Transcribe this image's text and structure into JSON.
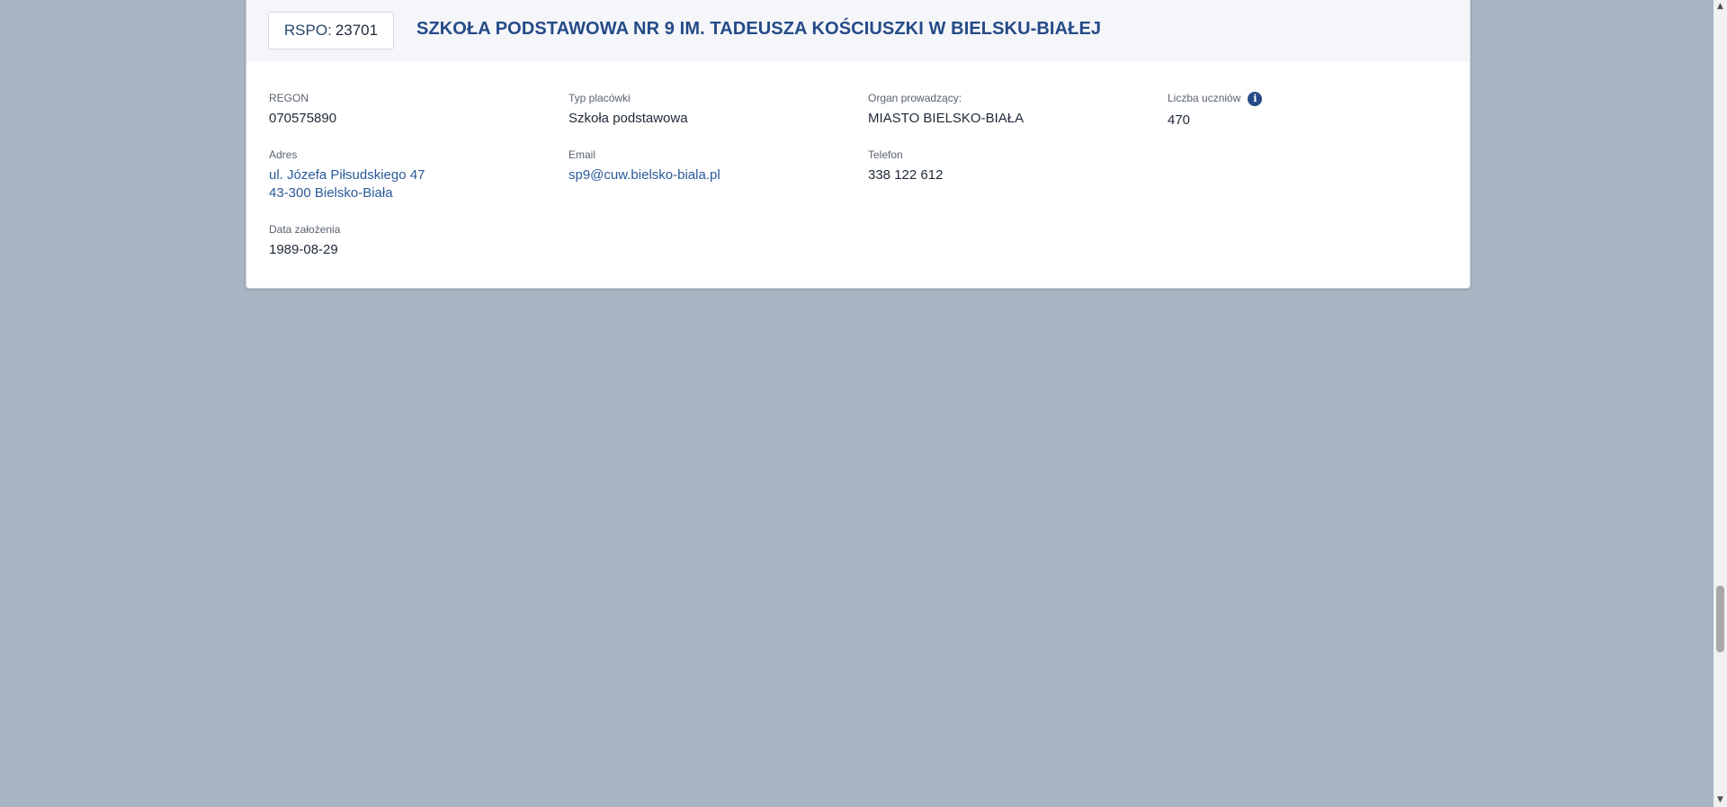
{
  "header": {
    "rspo_label": "RSPO:",
    "rspo_value": "23701",
    "school_name": "SZKOŁA PODSTAWOWA NR 9 IM. TADEUSZA KOŚCIUSZKI W BIELSKU-BIAŁEJ"
  },
  "fields": {
    "regon": {
      "label": "REGON",
      "value": "070575890"
    },
    "typ": {
      "label": "Typ placówki",
      "value": "Szkoła podstawowa"
    },
    "organ": {
      "label": "Organ prowadzący:",
      "value": "MIASTO BIELSKO-BIAŁA"
    },
    "uczniowie": {
      "label": "Liczba uczniów",
      "value": "470",
      "icon": "info-icon"
    },
    "adres": {
      "label": "Adres",
      "line1": "ul. Józefa Piłsudskiego 47",
      "line2": "43-300 Bielsko-Biała"
    },
    "email": {
      "label": "Email",
      "value": "sp9@cuw.bielsko-biala.pl"
    },
    "telefon": {
      "label": "Telefon",
      "value": "338 122 612"
    },
    "data": {
      "label": "Data założenia",
      "value": "1989-08-29"
    }
  },
  "colors": {
    "background": "#a9b4c2",
    "title": "#254a88",
    "link": "#2a5a9a"
  }
}
